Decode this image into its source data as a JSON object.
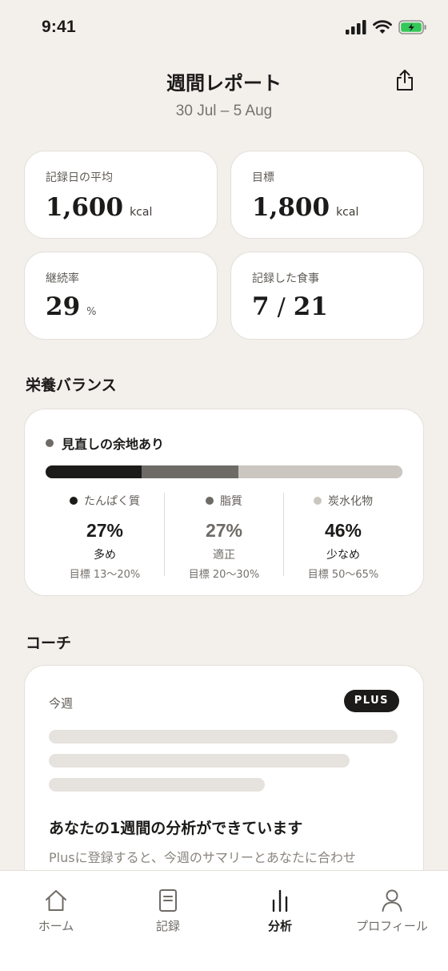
{
  "status_bar": {
    "time": "9:41",
    "icons": [
      "cellular-signal-icon",
      "wifi-icon",
      "battery-charging-icon"
    ]
  },
  "header": {
    "title": "週間レポート",
    "date_range": "30 Jul – 5 Aug",
    "share_icon": "share-icon"
  },
  "stats": {
    "avg": {
      "label": "記録日の平均",
      "value": "1,600",
      "unit": "kcal"
    },
    "goal": {
      "label": "目標",
      "value": "1,800",
      "unit": "kcal"
    },
    "streak": {
      "label": "継続率",
      "value": "29",
      "unit": "%"
    },
    "meals": {
      "label": "記録した食事",
      "logged": "7",
      "separator": "/",
      "total": "21"
    }
  },
  "nutrition": {
    "section_title": "栄養バランス",
    "status": "見直しの余地あり",
    "macros": [
      {
        "name": "たんぱく質",
        "percent": "27%",
        "share": 27,
        "status": "多め",
        "target": "目標 13〜20%",
        "color": "#1C1B1A"
      },
      {
        "name": "脂質",
        "percent": "27%",
        "share": 27,
        "status": "適正",
        "target": "目標 20〜30%",
        "color": "#6E6A66"
      },
      {
        "name": "炭水化物",
        "percent": "46%",
        "share": 46,
        "status": "少なめ",
        "target": "目標 50〜65%",
        "color": "#CBC6C0"
      }
    ]
  },
  "coach": {
    "section_title": "コーチ",
    "label": "今週",
    "badge": "PLUS",
    "headline": "あなたの1週間の分析ができています",
    "description": "Plusに登録すると、今週のサマリーとあなたに合わせ"
  },
  "tabs": [
    {
      "label": "ホーム",
      "icon": "home-icon",
      "active": false
    },
    {
      "label": "記録",
      "icon": "notebook-icon",
      "active": false
    },
    {
      "label": "分析",
      "icon": "analytics-icon",
      "active": true
    },
    {
      "label": "プロフィール",
      "icon": "profile-icon",
      "active": false
    }
  ]
}
